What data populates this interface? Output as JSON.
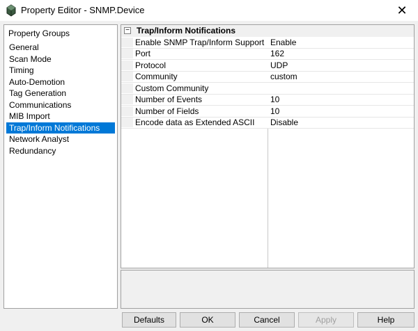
{
  "window": {
    "title": "Property Editor - SNMP.Device",
    "close_glyph": "✕"
  },
  "groups": {
    "header": "Property Groups",
    "items": [
      {
        "label": "General",
        "selected": false
      },
      {
        "label": "Scan Mode",
        "selected": false
      },
      {
        "label": "Timing",
        "selected": false
      },
      {
        "label": "Auto-Demotion",
        "selected": false
      },
      {
        "label": "Tag Generation",
        "selected": false
      },
      {
        "label": "Communications",
        "selected": false
      },
      {
        "label": "MIB Import",
        "selected": false
      },
      {
        "label": "Trap/Inform Notifications",
        "selected": true
      },
      {
        "label": "Network Analyst",
        "selected": false
      },
      {
        "label": "Redundancy",
        "selected": false
      }
    ]
  },
  "grid": {
    "category": "Trap/Inform Notifications",
    "expander_glyph": "−",
    "rows": [
      {
        "name": "Enable SNMP Trap/Inform Support",
        "value": "Enable"
      },
      {
        "name": "Port",
        "value": "162"
      },
      {
        "name": "Protocol",
        "value": "UDP"
      },
      {
        "name": "Community",
        "value": "custom"
      },
      {
        "name": "Custom Community",
        "value": ""
      },
      {
        "name": "Number of Events",
        "value": "10"
      },
      {
        "name": "Number of Fields",
        "value": "10"
      },
      {
        "name": "Encode data as Extended ASCII",
        "value": "Disable"
      }
    ]
  },
  "buttons": {
    "defaults": "Defaults",
    "ok": "OK",
    "cancel": "Cancel",
    "apply": "Apply",
    "help": "Help"
  },
  "colors": {
    "selection": "#0078d7"
  }
}
